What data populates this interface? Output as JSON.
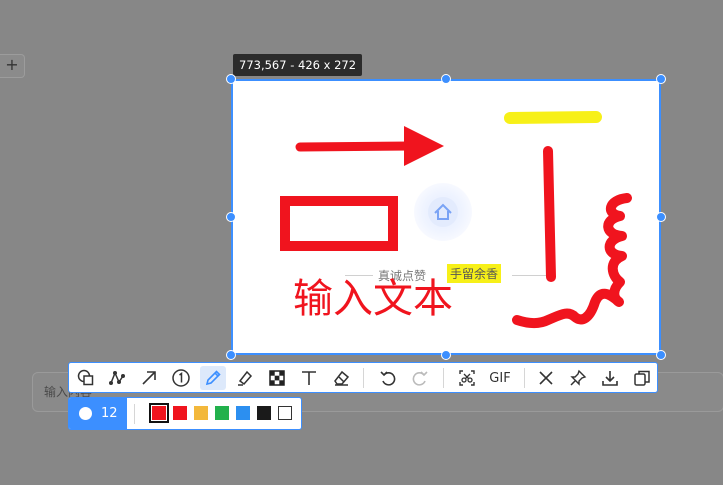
{
  "background": {
    "plus_label": "+",
    "input_placeholder": "输入内容"
  },
  "capture": {
    "size_label": "773,567 - 426 x 272",
    "border_color": "#3c8fff"
  },
  "canvas": {
    "watermark_text": "真诚点赞",
    "watermark_highlight": "手留余香",
    "typed_text": "输入文本",
    "highlight_color": "#f7f018",
    "pen_color": "#f0141e"
  },
  "toolbar": {
    "tools": [
      "shape-icon",
      "polyline-icon",
      "arrow-icon",
      "number-marker-icon",
      "pen-icon",
      "highlighter-icon",
      "mosaic-icon",
      "text-icon",
      "eraser-icon",
      "undo-icon",
      "redo-icon",
      "scroll-capture-icon",
      "gif-button",
      "close-icon",
      "pin-icon",
      "download-icon",
      "copy-icon"
    ],
    "gif_label": "GIF",
    "active_tool": "pen-icon"
  },
  "pen_settings": {
    "size": "12",
    "colors": [
      "#f0141e",
      "#f0141e",
      "#f3b83b",
      "#22b14c",
      "#2c8ff0",
      "#1a1a1a",
      "#ffffff"
    ],
    "selected_color_index": 0
  }
}
